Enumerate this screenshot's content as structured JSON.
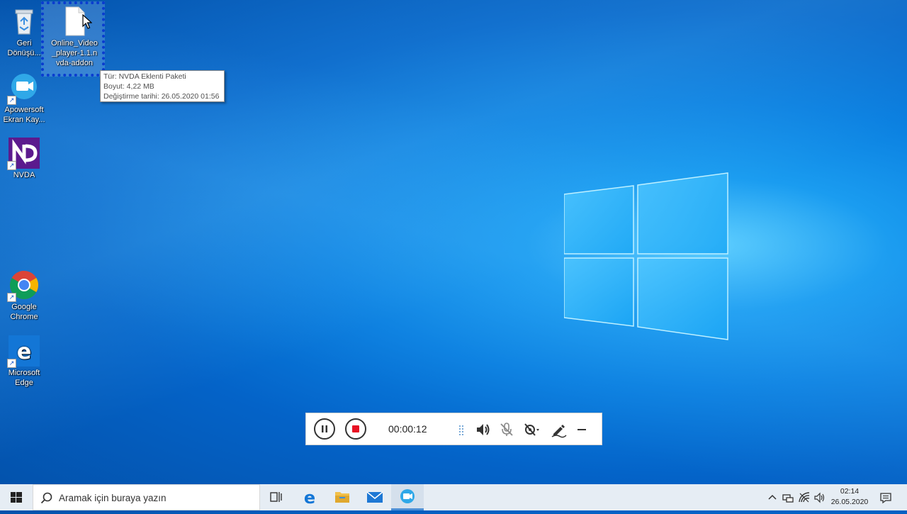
{
  "desktop": {
    "icons": [
      {
        "label": "Geri Dönüşü..."
      },
      {
        "label": "Online_Video_player-1.1.nvda-addon"
      },
      {
        "label": "Apowersoft Ekran Kay..."
      },
      {
        "label": "NVDA"
      },
      {
        "label": "Google Chrome"
      },
      {
        "label": "Microsoft Edge"
      }
    ],
    "selected_icon_lines": [
      "Online_Video",
      "_player-1.1.n",
      "vda-addon"
    ]
  },
  "tooltip": {
    "type_line": "Tür: NVDA Eklenti Paketi",
    "size_line": "Boyut: 4,22 MB",
    "modified_line": "Değiştirme tarihi: 26.05.2020 01:56"
  },
  "recorder": {
    "timer": "00:00:12"
  },
  "taskbar": {
    "search_placeholder": "Aramak için buraya yazın",
    "clock_time": "02:14",
    "clock_date": "26.05.2020"
  },
  "colors": {
    "accent": "#0078d7",
    "record_red": "#e81123",
    "selection_border": "#0a3ccf"
  }
}
